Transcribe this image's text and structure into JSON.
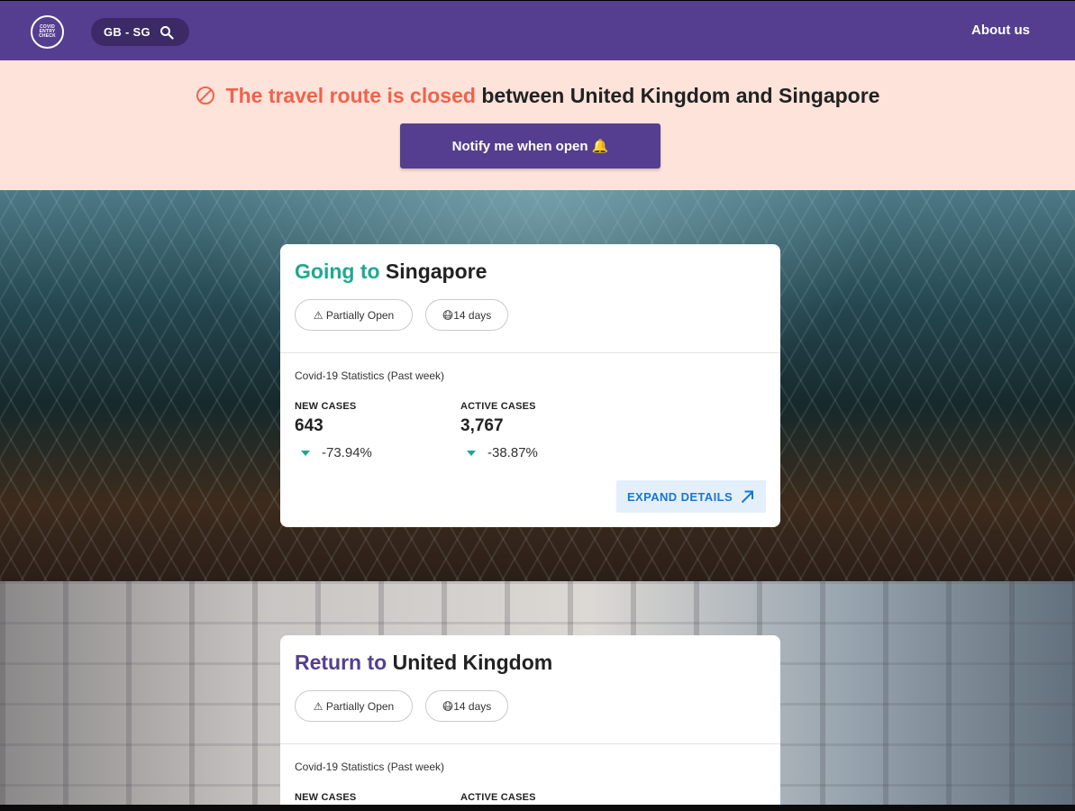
{
  "header": {
    "logo_text": "COVID\nENTRY\nCHECK",
    "route": "GB - SG",
    "search_icon": "search-icon",
    "about_label": "About us",
    "bg_color": "#553e8f"
  },
  "banner": {
    "icon": "ban-icon",
    "status_text": "The travel route is closed",
    "detail_text": "between United Kingdom and Singapore",
    "notify_label": "Notify me when open 🔔",
    "bg_color": "#fde3da",
    "status_color": "#f0624d"
  },
  "going": {
    "prefix": "Going to",
    "destination": "Singapore",
    "status_tag": "⚠ Partially Open",
    "quarantine_tag": "😷14 days",
    "stats_label": "Covid-19 Statistics (Past week)",
    "new_cases": {
      "label": "NEW CASES",
      "value": "643",
      "change": "-73.94%"
    },
    "active_cases": {
      "label": "ACTIVE CASES",
      "value": "3,767",
      "change": "-38.87%"
    },
    "expand_label": "EXPAND DETAILS"
  },
  "return": {
    "prefix": "Return to",
    "destination": "United Kingdom",
    "status_tag": "⚠ Partially Open",
    "quarantine_tag": "😷14 days",
    "stats_label": "Covid-19 Statistics (Past week)",
    "new_cases": {
      "label": "NEW CASES"
    },
    "active_cases": {
      "label": "ACTIVE CASES"
    }
  }
}
